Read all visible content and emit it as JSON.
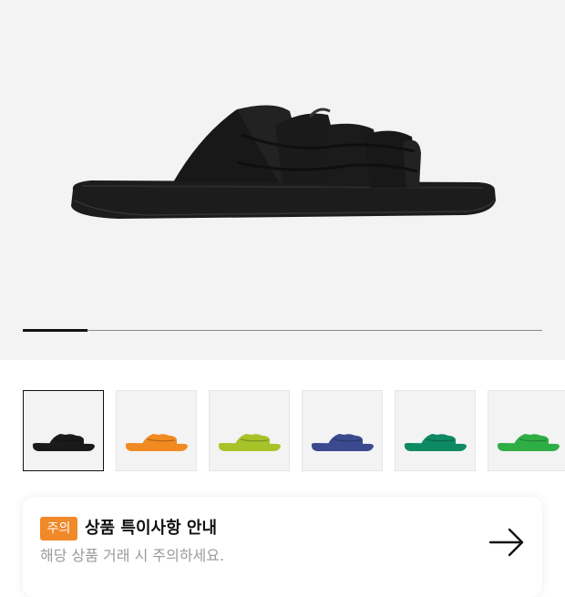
{
  "product": {
    "image_alt": "black woven slide sandal",
    "image_progress": 0.125
  },
  "variants": [
    {
      "color_name": "black",
      "color": "#1a1a1a",
      "selected": true
    },
    {
      "color_name": "orange",
      "color": "#f08a21",
      "selected": false
    },
    {
      "color_name": "lime",
      "color": "#a8c22a",
      "selected": false
    },
    {
      "color_name": "navy",
      "color": "#3b4a8f",
      "selected": false
    },
    {
      "color_name": "teal",
      "color": "#0d8a63",
      "selected": false
    },
    {
      "color_name": "green",
      "color": "#2fae45",
      "selected": false
    }
  ],
  "notice": {
    "badge": "주의",
    "title": "상품 특이사항 안내",
    "subtitle": "해당 상품 거래 시 주의하세요.",
    "arrow_icon": "arrow-right-icon"
  },
  "colors": {
    "accent": "#f0892a",
    "hero_bg": "#f3f3f3",
    "progress_fill": "#111111"
  }
}
